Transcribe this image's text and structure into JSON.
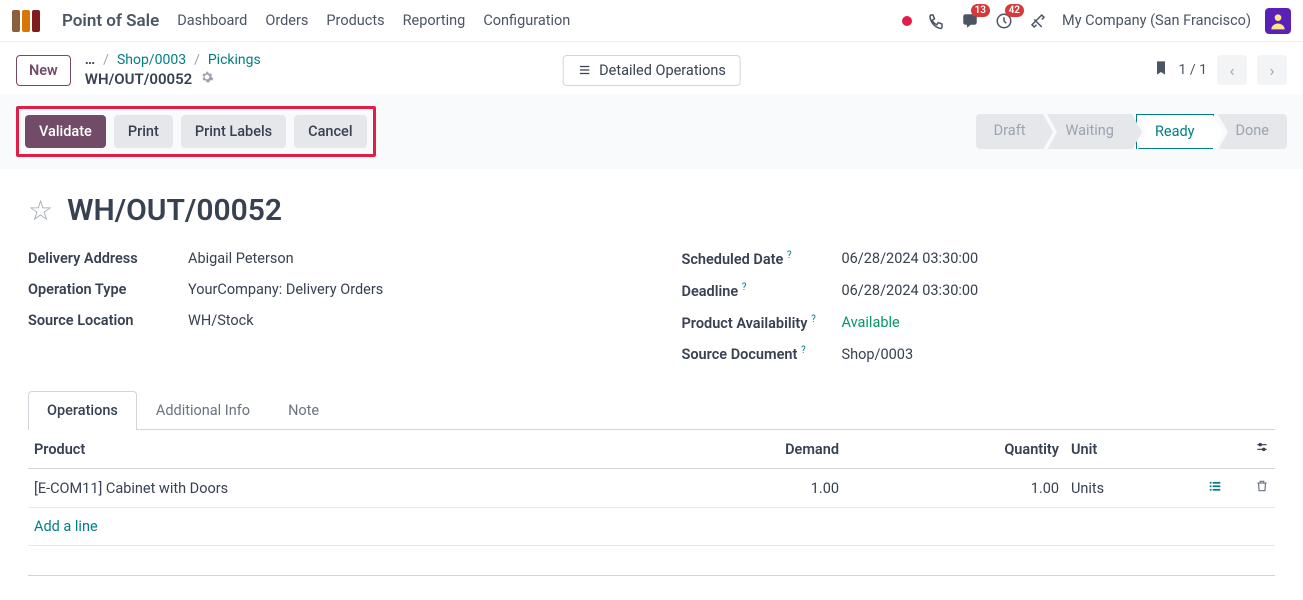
{
  "topbar": {
    "app": "Point of Sale",
    "nav": [
      "Dashboard",
      "Orders",
      "Products",
      "Reporting",
      "Configuration"
    ],
    "messages_badge": "13",
    "activities_badge": "42",
    "company": "My Company (San Francisco)"
  },
  "subheader": {
    "new": "New",
    "ellipsis": "…",
    "crumb1": "Shop/0003",
    "crumb2": "Pickings",
    "doc": "WH/OUT/00052",
    "detailed": "Detailed Operations",
    "pager": "1 / 1"
  },
  "actions": {
    "validate": "Validate",
    "print": "Print",
    "print_labels": "Print Labels",
    "cancel": "Cancel"
  },
  "status": {
    "draft": "Draft",
    "waiting": "Waiting",
    "ready": "Ready",
    "done": "Done"
  },
  "record": {
    "title": "WH/OUT/00052",
    "left": {
      "delivery_address_label": "Delivery Address",
      "delivery_address": "Abigail Peterson",
      "operation_type_label": "Operation Type",
      "operation_type": "YourCompany: Delivery Orders",
      "source_location_label": "Source Location",
      "source_location": "WH/Stock"
    },
    "right": {
      "scheduled_label": "Scheduled Date",
      "scheduled": "06/28/2024 03:30:00",
      "deadline_label": "Deadline",
      "deadline": "06/28/2024 03:30:00",
      "availability_label": "Product Availability",
      "availability": "Available",
      "source_doc_label": "Source Document",
      "source_doc": "Shop/0003"
    }
  },
  "tabs": {
    "operations": "Operations",
    "additional": "Additional Info",
    "note": "Note"
  },
  "table": {
    "cols": {
      "product": "Product",
      "demand": "Demand",
      "quantity": "Quantity",
      "unit": "Unit"
    },
    "rows": [
      {
        "product": "[E-COM11] Cabinet with Doors",
        "demand": "1.00",
        "quantity": "1.00",
        "unit": "Units"
      }
    ],
    "add_line": "Add a line"
  }
}
